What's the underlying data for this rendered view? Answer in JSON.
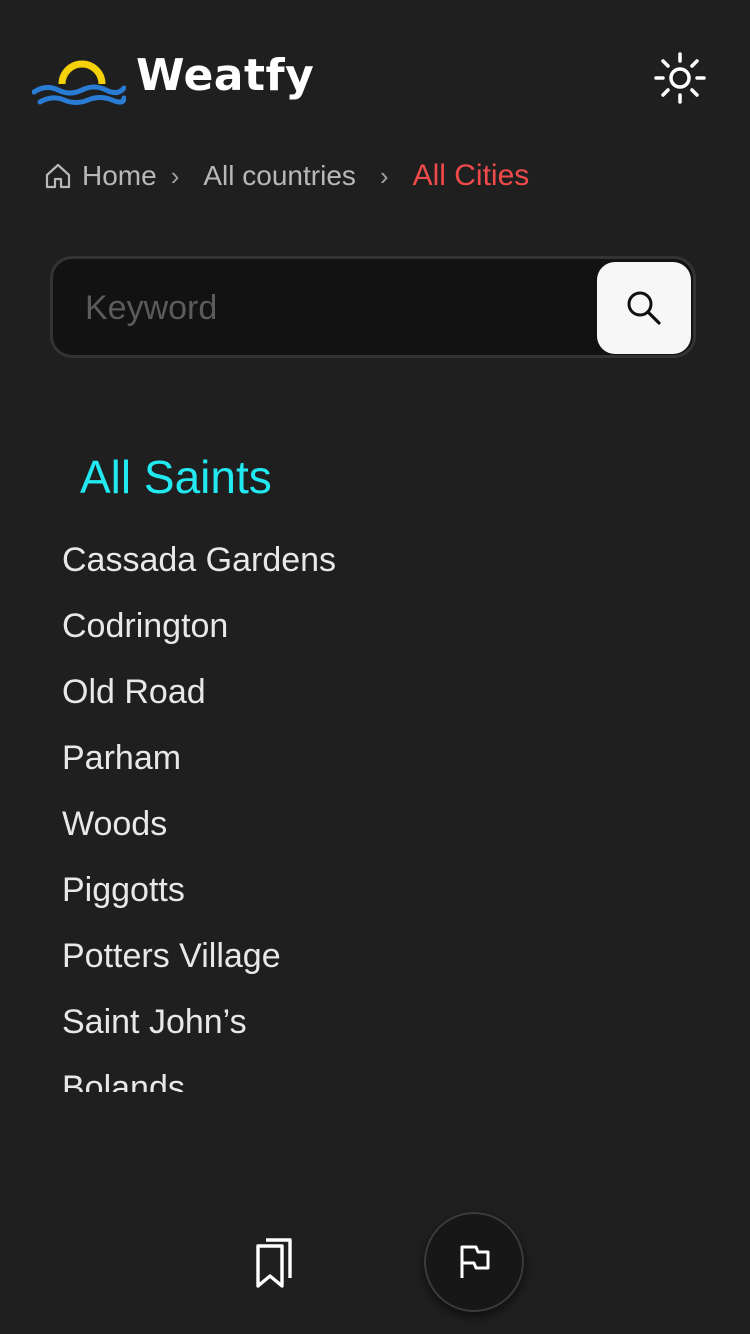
{
  "app": {
    "title": "Weatfy",
    "logo_icon": "sun-over-waves-logo",
    "theme_toggle_icon": "sun-icon"
  },
  "breadcrumb": {
    "home_icon": "home-icon",
    "home": "Home",
    "countries": "All countries",
    "current": "All Cities",
    "separator": "›"
  },
  "search": {
    "placeholder": "Keyword",
    "value": "",
    "button_icon": "search-icon"
  },
  "region": {
    "title": "All Saints"
  },
  "cities": [
    "Cassada Gardens",
    "Codrington",
    "Old Road",
    "Parham",
    "Woods",
    "Piggotts",
    "Potters Village",
    "Saint John’s",
    "Bolands"
  ],
  "bottom_nav": {
    "bookmark_icon": "bookmarks-icon",
    "flag_icon": "flag-icon"
  },
  "colors": {
    "background": "#1f1f20",
    "accent_red": "#f04a4a",
    "accent_cyan": "#22e8f0",
    "logo_yellow": "#f5d10a",
    "logo_blue": "#2a7bd4"
  }
}
